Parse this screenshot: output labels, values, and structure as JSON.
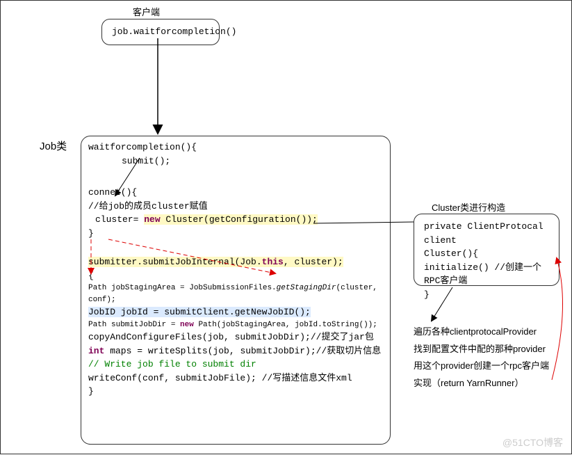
{
  "labels": {
    "client": "客户端",
    "job_class": "Job类",
    "cluster_class": "Cluster类进行构造",
    "watermark": "@51CTO博客"
  },
  "client_box": {
    "call": "job.waitforcompletion()"
  },
  "main": {
    "l1": "waitforcompletion(){",
    "l2": "submit();",
    "l3": "connet(){",
    "l4": "//给job的成员cluster赋值",
    "l5a": "cluster= ",
    "l5b": "new",
    "l5c": " Cluster(getConfiguration());",
    "l6": "}",
    "l7a": "submitter.submitJobInternal(Job.",
    "l7b": "this",
    "l7c": ", cluster);",
    "l8": "{",
    "l9a": "Path jobStagingArea = JobSubmissionFiles.",
    "l9b": "getStagingDir",
    "l9c": "(cluster, conf);",
    "l10": "JobID jobId = submitClient.getNewJobID();",
    "l11a": "Path submitJobDir = ",
    "l11b": "new",
    "l11c": " Path(jobStagingArea, jobId.toString());",
    "l12": "copyAndConfigureFiles(job, submitJobDir);//提交了jar包",
    "l13a": "int",
    "l13b": " maps = writeSplits(job, submitJobDir);//获取切片信息",
    "l14": "// Write job file to submit dir",
    "l15": "writeConf(conf, submitJobFile); //写描述信息文件xml",
    "l16": "}"
  },
  "cluster": {
    "c1": "private ClientProtocal client",
    "c2": "Cluster(){",
    "c3": "initialize()  //创建一个RPC客户端",
    "c4": "}"
  },
  "desc": {
    "d1": "遍历各种clientprotocalProvider",
    "d2": "找到配置文件中配的那种provider",
    "d3": "用这个provider创建一个rpc客户端",
    "d4": "实现（return   YarnRunner）"
  }
}
